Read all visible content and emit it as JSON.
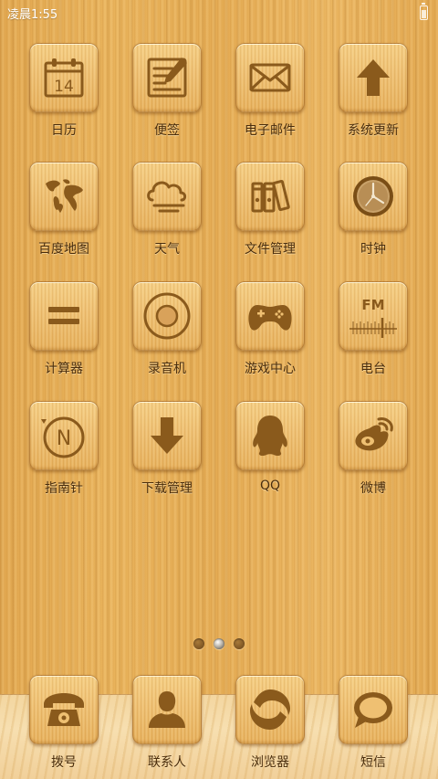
{
  "status_bar": {
    "time": "凌晨1:55"
  },
  "apps": [
    {
      "label": "日历",
      "icon": "calendar-icon",
      "date": "14"
    },
    {
      "label": "便签",
      "icon": "notepad-icon"
    },
    {
      "label": "电子邮件",
      "icon": "mail-icon"
    },
    {
      "label": "系统更新",
      "icon": "up-arrow-icon"
    },
    {
      "label": "百度地图",
      "icon": "world-map-icon"
    },
    {
      "label": "天气",
      "icon": "cloud-wind-icon"
    },
    {
      "label": "文件管理",
      "icon": "binders-icon"
    },
    {
      "label": "时钟",
      "icon": "clock-icon"
    },
    {
      "label": "计算器",
      "icon": "equals-icon"
    },
    {
      "label": "录音机",
      "icon": "record-circle-icon"
    },
    {
      "label": "游戏中心",
      "icon": "gamepad-icon"
    },
    {
      "label": "电台",
      "icon": "fm-radio-icon",
      "badge_text": "FM"
    },
    {
      "label": "指南针",
      "icon": "compass-n-icon",
      "badge_text": "N"
    },
    {
      "label": "下载管理",
      "icon": "down-arrow-icon"
    },
    {
      "label": "QQ",
      "icon": "penguin-icon"
    },
    {
      "label": "微博",
      "icon": "weibo-icon"
    }
  ],
  "page_indicator": {
    "pages": 3,
    "current": 2
  },
  "dock": [
    {
      "label": "拨号",
      "icon": "phone-icon"
    },
    {
      "label": "联系人",
      "icon": "contact-person-icon"
    },
    {
      "label": "浏览器",
      "icon": "browser-swirl-icon"
    },
    {
      "label": "短信",
      "icon": "speech-bubble-icon"
    }
  ],
  "colors": {
    "wood_light": "#efc072",
    "wood_dark": "#e3a951",
    "ink": "#8a5a1c",
    "label": "#4a2d0c",
    "shelf": "#f3d6a0"
  }
}
